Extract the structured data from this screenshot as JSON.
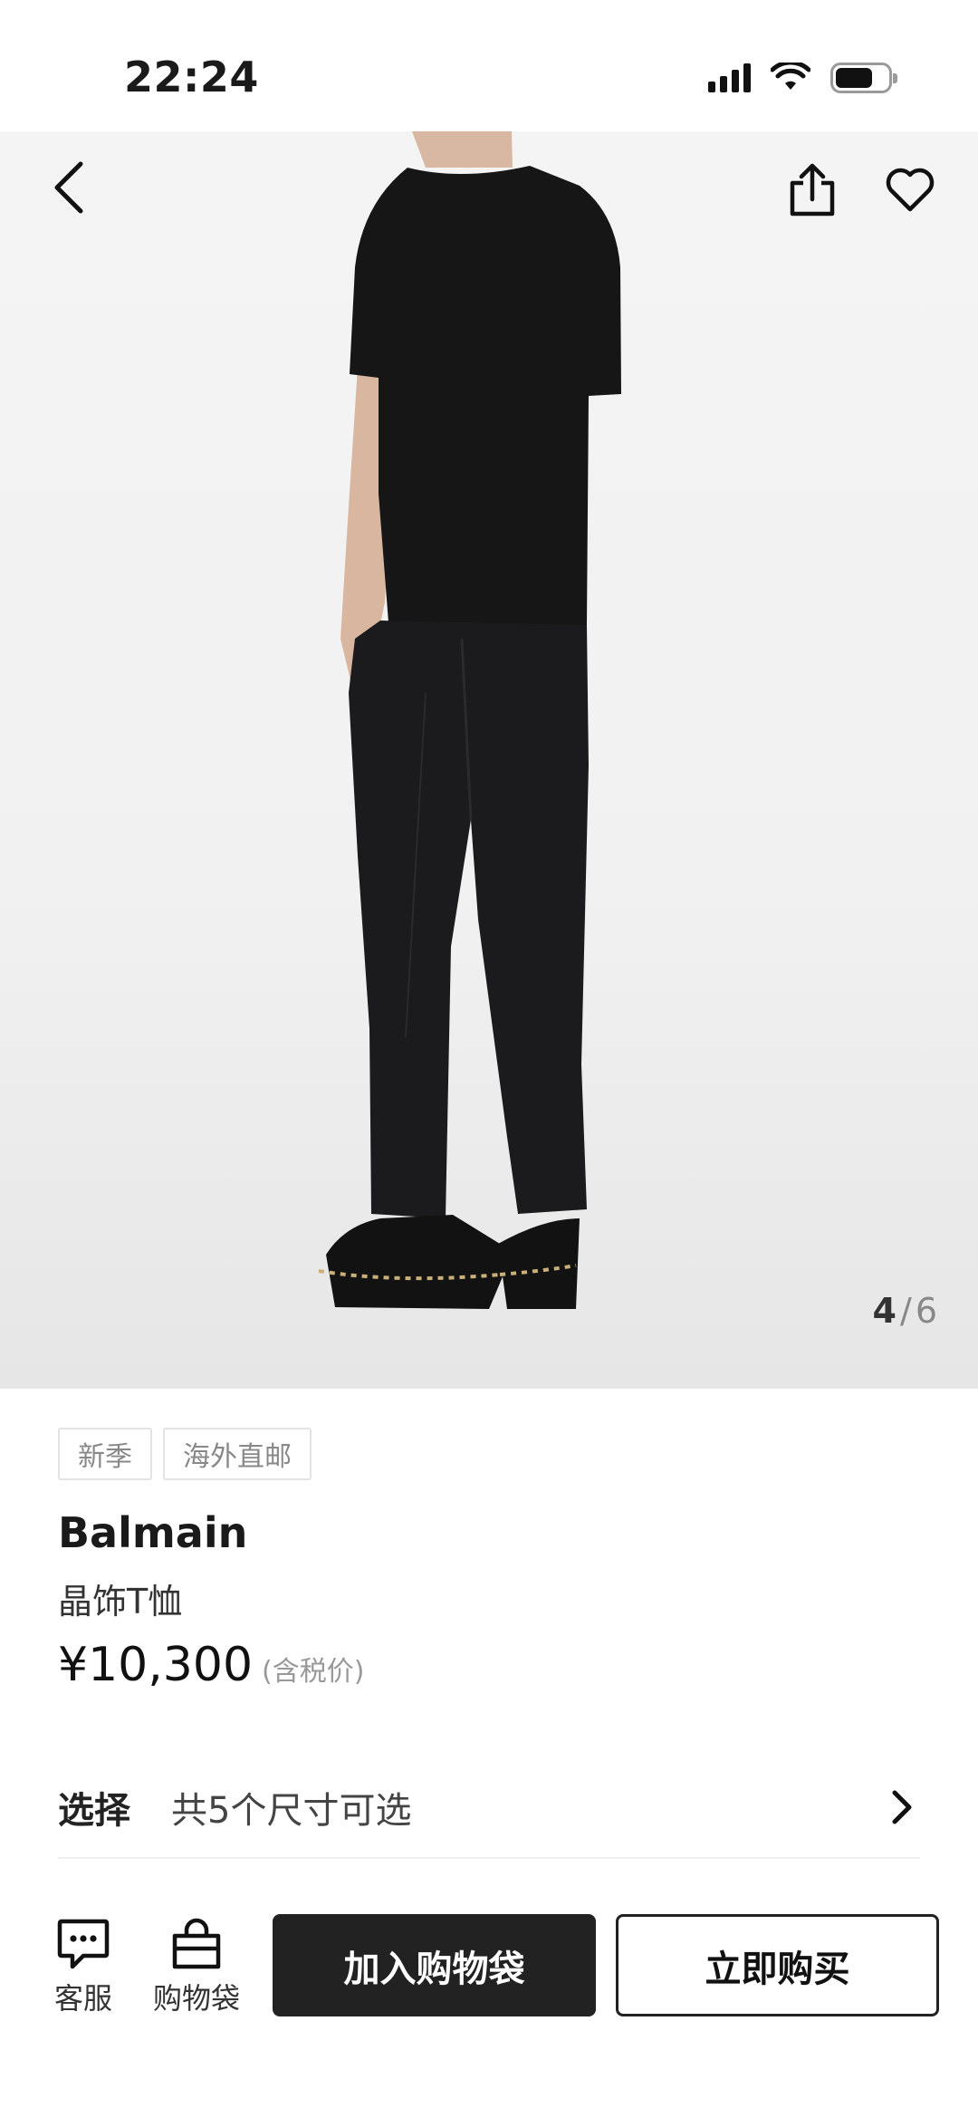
{
  "status_bar": {
    "time": "22:24"
  },
  "gallery": {
    "current_page": "4",
    "separator": "/",
    "total_pages": "6"
  },
  "tags": [
    "新季",
    "海外直邮"
  ],
  "product": {
    "brand": "Balmain",
    "name": "晶饰T恤",
    "price": "¥10,300",
    "price_note": "(含税价)"
  },
  "size_select": {
    "label": "选择",
    "value": "共5个尺寸可选"
  },
  "bottom_bar": {
    "customer_service_label": "客服",
    "shopping_bag_label": "购物袋",
    "add_to_bag_label": "加入购物袋",
    "buy_now_label": "立即购买"
  },
  "icons": {
    "back": "chevron-left-icon",
    "share": "share-icon",
    "favorite": "heart-icon",
    "select_arrow": "chevron-right-icon",
    "customer_service": "chat-bubble-icon",
    "shopping_bag": "shopping-bag-icon"
  },
  "colors": {
    "primary_button": "#222222",
    "page_background": "#ffffff",
    "image_background": "#f2f2f2"
  }
}
